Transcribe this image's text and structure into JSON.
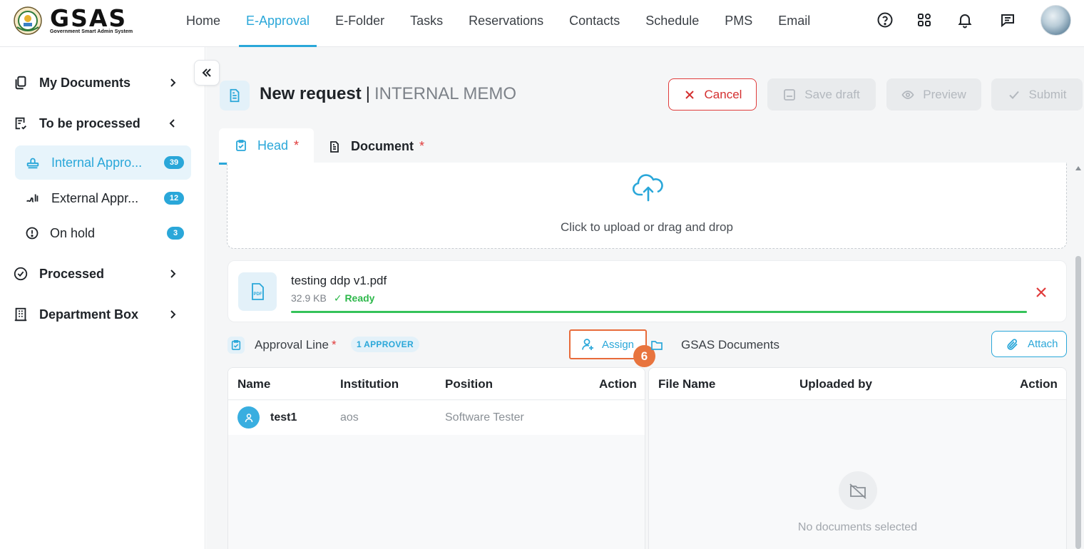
{
  "brand": {
    "name": "GSAS",
    "tagline": "Government Smart Admin System"
  },
  "nav": {
    "items": [
      {
        "label": "Home"
      },
      {
        "label": "E-Approval",
        "active": true
      },
      {
        "label": "E-Folder"
      },
      {
        "label": "Tasks"
      },
      {
        "label": "Reservations"
      },
      {
        "label": "Contacts"
      },
      {
        "label": "Schedule"
      },
      {
        "label": "PMS"
      },
      {
        "label": "Email"
      }
    ],
    "icons": [
      "help-icon",
      "apps-grid-icon",
      "bell-icon",
      "chat-icon"
    ]
  },
  "sidebar": {
    "items": [
      {
        "label": "My Documents",
        "icon": "documents-icon"
      },
      {
        "label": "To be processed",
        "icon": "todo-list-icon"
      },
      {
        "label": "Processed",
        "icon": "check-circle-icon"
      },
      {
        "label": "Department Box",
        "icon": "building-icon"
      }
    ],
    "subitems": [
      {
        "label": "Internal Appro...",
        "badge": "39",
        "icon": "stamp-icon"
      },
      {
        "label": "External Appr...",
        "badge": "12",
        "icon": "signature-icon"
      },
      {
        "label": "On hold",
        "badge": "3",
        "icon": "alert-circle-icon"
      }
    ]
  },
  "page": {
    "title_main": "New request",
    "title_sep": "|",
    "title_sub": "INTERNAL MEMO"
  },
  "actions": {
    "cancel": "Cancel",
    "save_draft": "Save draft",
    "preview": "Preview",
    "submit": "Submit"
  },
  "tabs": [
    {
      "label": "Head",
      "required": "*"
    },
    {
      "label": "Document",
      "required": "*"
    }
  ],
  "upload": {
    "text": "Click to upload or drag and drop"
  },
  "file": {
    "name": "testing ddp v1.pdf",
    "size": "32.9 KB",
    "status": "✓ Ready",
    "progress_percent": 100,
    "type_label": "PDF"
  },
  "approval": {
    "label": "Approval Line",
    "required": "*",
    "count_badge": "1 APPROVER",
    "assign_label": "Assign",
    "step_number": "6",
    "columns": [
      "Name",
      "Institution",
      "Position",
      "Action"
    ],
    "rows": [
      {
        "name": "test1",
        "institution": "aos",
        "position": "Software Tester"
      }
    ]
  },
  "documents": {
    "label": "GSAS Documents",
    "attach_label": "Attach",
    "columns": [
      "File Name",
      "Uploaded by",
      "Action"
    ],
    "empty_text": "No documents selected"
  },
  "colors": {
    "accent": "#2aa7d9",
    "danger": "#e03b3b",
    "success": "#35c35a",
    "highlight": "#e86b3a"
  }
}
